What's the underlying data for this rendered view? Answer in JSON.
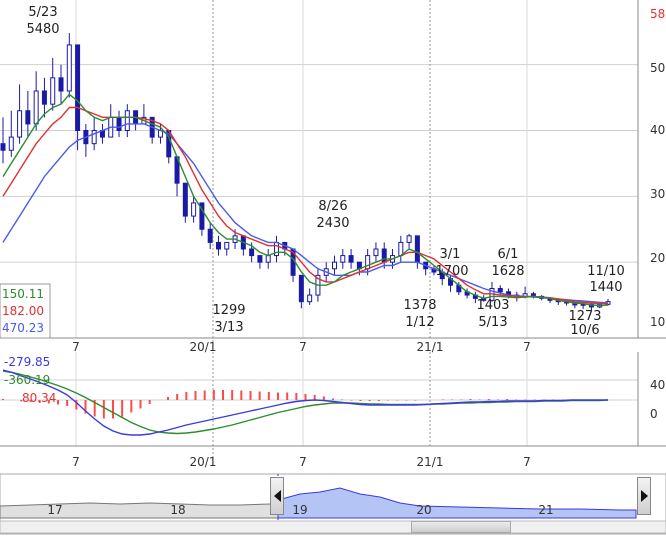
{
  "chart_data": {
    "type": "candlestick",
    "price_panel": {
      "ylim": [
        1000,
        5800
      ],
      "y_tick_labels": [
        "58",
        "50",
        "40",
        "30",
        "20",
        "10"
      ],
      "x_tick_labels": [
        "7",
        "20/1",
        "7",
        "21/1",
        "7"
      ],
      "candles": [
        [
          3800,
          3700,
          4200,
          3500
        ],
        [
          3700,
          3900,
          4300,
          3600
        ],
        [
          3900,
          4300,
          4700,
          3800
        ],
        [
          4300,
          4100,
          4600,
          3900
        ],
        [
          4100,
          4600,
          4900,
          4000
        ],
        [
          4600,
          4400,
          4800,
          4200
        ],
        [
          4400,
          4800,
          5100,
          4300
        ],
        [
          4800,
          4600,
          5000,
          4400
        ],
        [
          4600,
          5300,
          5480,
          4500
        ],
        [
          5300,
          4000,
          5300,
          3700
        ],
        [
          4000,
          3800,
          4100,
          3600
        ],
        [
          3800,
          4000,
          4200,
          3700
        ],
        [
          4000,
          3900,
          4100,
          3800
        ],
        [
          3900,
          4200,
          4400,
          3900
        ],
        [
          4200,
          4000,
          4300,
          3900
        ],
        [
          4000,
          4300,
          4400,
          3900
        ],
        [
          4300,
          4100,
          4300,
          4000
        ],
        [
          4100,
          4200,
          4400,
          4100
        ],
        [
          4200,
          3900,
          4200,
          3800
        ],
        [
          3900,
          4000,
          4100,
          3800
        ],
        [
          4000,
          3600,
          4000,
          3500
        ],
        [
          3600,
          3200,
          3600,
          3000
        ],
        [
          3200,
          2700,
          3200,
          2600
        ],
        [
          2700,
          2900,
          3000,
          2600
        ],
        [
          2900,
          2500,
          2900,
          2400
        ],
        [
          2500,
          2300,
          2600,
          2200
        ],
        [
          2300,
          2200,
          2400,
          2100
        ],
        [
          2200,
          2300,
          2300,
          2100
        ],
        [
          2300,
          2400,
          2500,
          2200
        ],
        [
          2400,
          2200,
          2400,
          2100
        ],
        [
          2200,
          2100,
          2300,
          2000
        ],
        [
          2100,
          2000,
          2100,
          1900
        ],
        [
          2000,
          2100,
          2200,
          1900
        ],
        [
          2100,
          2300,
          2400,
          2000
        ],
        [
          2300,
          2200,
          2300,
          2100
        ],
        [
          2200,
          1800,
          2200,
          1700
        ],
        [
          1800,
          1400,
          1800,
          1299
        ],
        [
          1400,
          1500,
          1600,
          1350
        ],
        [
          1500,
          1800,
          1900,
          1400
        ],
        [
          1800,
          1900,
          2000,
          1700
        ],
        [
          1900,
          2000,
          2100,
          1800
        ],
        [
          2000,
          2100,
          2200,
          1900
        ],
        [
          2100,
          2000,
          2200,
          1900
        ],
        [
          2000,
          1900,
          2000,
          1800
        ],
        [
          1900,
          2100,
          2200,
          1800
        ],
        [
          2100,
          2200,
          2300,
          2000
        ],
        [
          2200,
          2000,
          2300,
          1900
        ],
        [
          2000,
          2100,
          2200,
          1900
        ],
        [
          2100,
          2300,
          2400,
          2000
        ],
        [
          2300,
          2400,
          2430,
          2200
        ],
        [
          2400,
          2000,
          2400,
          1900
        ],
        [
          2000,
          1900,
          2000,
          1800
        ],
        [
          1900,
          1850,
          1950,
          1800
        ],
        [
          1850,
          1750,
          1900,
          1650
        ],
        [
          1750,
          1650,
          1800,
          1550
        ],
        [
          1650,
          1550,
          1700,
          1500
        ],
        [
          1550,
          1500,
          1600,
          1450
        ],
        [
          1500,
          1450,
          1550,
          1378
        ],
        [
          1450,
          1420,
          1500,
          1400
        ],
        [
          1420,
          1600,
          1700,
          1400
        ],
        [
          1600,
          1550,
          1650,
          1500
        ],
        [
          1550,
          1500,
          1600,
          1450
        ],
        [
          1500,
          1470,
          1550,
          1403
        ],
        [
          1470,
          1520,
          1628,
          1450
        ],
        [
          1520,
          1480,
          1550,
          1450
        ],
        [
          1480,
          1450,
          1500,
          1420
        ],
        [
          1450,
          1420,
          1470,
          1380
        ],
        [
          1420,
          1400,
          1450,
          1350
        ],
        [
          1400,
          1380,
          1430,
          1340
        ],
        [
          1380,
          1350,
          1400,
          1300
        ],
        [
          1350,
          1360,
          1380,
          1290
        ],
        [
          1360,
          1320,
          1380,
          1273
        ],
        [
          1320,
          1360,
          1380,
          1300
        ],
        [
          1360,
          1400,
          1440,
          1340
        ]
      ],
      "ma_short": [
        3300,
        3500,
        3700,
        3900,
        4100,
        4250,
        4350,
        4400,
        4550,
        4450,
        4300,
        4200,
        4150,
        4200,
        4200,
        4200,
        4200,
        4150,
        4100,
        4050,
        3900,
        3600,
        3300,
        3000,
        2800,
        2600,
        2450,
        2350,
        2350,
        2300,
        2250,
        2150,
        2100,
        2150,
        2150,
        2050,
        1850,
        1700,
        1650,
        1650,
        1700,
        1800,
        1850,
        1900,
        1950,
        2000,
        2050,
        2050,
        2100,
        2200,
        2150,
        2050,
        1950,
        1850,
        1750,
        1650,
        1550,
        1500,
        1450,
        1480,
        1480,
        1470,
        1460,
        1470,
        1480,
        1470,
        1450,
        1420,
        1400,
        1380,
        1370,
        1350,
        1340,
        1350
      ],
      "ma_mid": [
        3000,
        3200,
        3400,
        3600,
        3800,
        3950,
        4100,
        4200,
        4350,
        4350,
        4300,
        4250,
        4200,
        4200,
        4200,
        4200,
        4200,
        4180,
        4150,
        4100,
        4000,
        3800,
        3600,
        3350,
        3100,
        2900,
        2700,
        2550,
        2450,
        2400,
        2350,
        2300,
        2250,
        2250,
        2200,
        2150,
        2000,
        1850,
        1750,
        1700,
        1700,
        1750,
        1800,
        1850,
        1900,
        1950,
        2000,
        2050,
        2100,
        2150,
        2150,
        2100,
        2050,
        1950,
        1850,
        1750,
        1650,
        1580,
        1520,
        1520,
        1500,
        1490,
        1480,
        1480,
        1480,
        1470,
        1460,
        1440,
        1420,
        1400,
        1390,
        1380,
        1370,
        1370
      ],
      "ma_long": [
        2300,
        2500,
        2700,
        2900,
        3100,
        3300,
        3450,
        3600,
        3750,
        3850,
        3900,
        3950,
        4000,
        4050,
        4050,
        4100,
        4100,
        4100,
        4050,
        4000,
        3950,
        3800,
        3650,
        3500,
        3300,
        3100,
        2900,
        2750,
        2600,
        2500,
        2400,
        2350,
        2300,
        2300,
        2250,
        2200,
        2100,
        2000,
        1900,
        1850,
        1800,
        1800,
        1800,
        1850,
        1850,
        1900,
        1950,
        1950,
        2000,
        2000,
        2000,
        1950,
        1900,
        1850,
        1800,
        1750,
        1700,
        1650,
        1600,
        1560,
        1530,
        1500,
        1490,
        1480,
        1470,
        1460,
        1450,
        1440,
        1430,
        1420,
        1410,
        1400,
        1390,
        1380
      ],
      "annotations": [
        {
          "date": "5/23",
          "value": "5480"
        },
        {
          "date": "3/13",
          "value": "1299"
        },
        {
          "date": "8/26",
          "value": "2430"
        },
        {
          "date": "1/12",
          "value": "1378"
        },
        {
          "date": "3/1",
          "value": "1700"
        },
        {
          "date": "5/13",
          "value": "1403"
        },
        {
          "date": "6/1",
          "value": "1628"
        },
        {
          "date": "10/6",
          "value": "1273"
        },
        {
          "date": "11/10",
          "value": "1440"
        }
      ],
      "ma_labels": [
        "150.11",
        "182.00",
        "470.23"
      ]
    },
    "macd_panel": {
      "ylim": [
        -80,
        80
      ],
      "y_tick_labels": [
        "40",
        "0"
      ],
      "x_tick_labels": [
        "7",
        "20/1",
        "7",
        "21/1",
        "7"
      ],
      "macd": [
        60,
        55,
        48,
        42,
        35,
        28,
        20,
        10,
        -5,
        -22,
        -38,
        -52,
        -62,
        -68,
        -70,
        -70,
        -68,
        -64,
        -60,
        -55,
        -50,
        -46,
        -42,
        -38,
        -34,
        -30,
        -26,
        -22,
        -18,
        -14,
        -10,
        -6,
        -3,
        -1,
        0,
        -1,
        -3,
        -5,
        -7,
        -9,
        -10,
        -10,
        -10,
        -10,
        -10,
        -10,
        -9,
        -8,
        -7,
        -6,
        -5,
        -4,
        -4,
        -3,
        -3,
        -2,
        -2,
        -2,
        -2,
        -1,
        -1,
        -1,
        0,
        0,
        0,
        0,
        0
      ],
      "signal": [
        58,
        55,
        51,
        46,
        41,
        35,
        29,
        22,
        14,
        5,
        -5,
        -15,
        -25,
        -35,
        -45,
        -53,
        -60,
        -64,
        -66,
        -67,
        -66,
        -64,
        -61,
        -58,
        -54,
        -50,
        -45,
        -40,
        -35,
        -30,
        -25,
        -21,
        -17,
        -13,
        -10,
        -8,
        -6,
        -6,
        -6,
        -7,
        -8,
        -8,
        -9,
        -9,
        -9,
        -9,
        -9,
        -8,
        -8,
        -7,
        -6,
        -6,
        -5,
        -5,
        -4,
        -4,
        -3,
        -3,
        -3,
        -2,
        -2,
        -2,
        -1,
        -1,
        -1,
        -1,
        0
      ],
      "labels": [
        "-279.85",
        "-360.19",
        "80.34"
      ]
    },
    "navigator": {
      "labels": [
        "17",
        "18",
        "19",
        "20",
        "21"
      ]
    },
    "colors": {
      "up_candle": "#ffffff",
      "down_candle": "#1a1aa6",
      "ma_short": "#2e8b2e",
      "ma_mid": "#e03030",
      "ma_long": "#4a5ce8",
      "macd_line": "#3a3ae0",
      "signal_line": "#2e8b2e",
      "hist_bar": "#ff4a4a",
      "nav_fill": "#b3c4f5"
    }
  }
}
